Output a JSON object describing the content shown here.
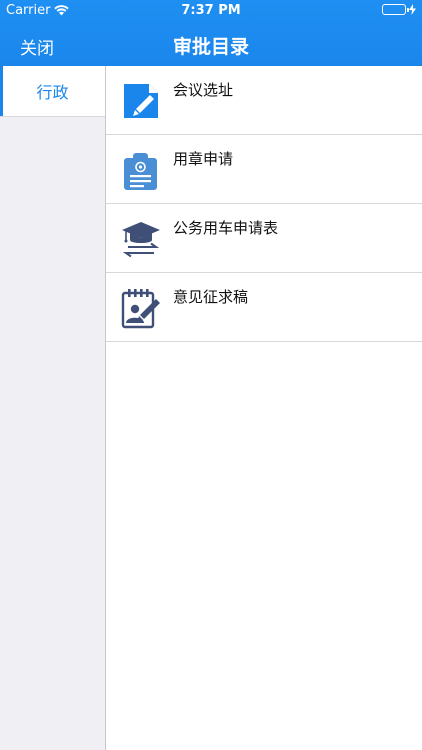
{
  "status_bar": {
    "carrier": "Carrier",
    "time": "7:37 PM"
  },
  "nav": {
    "close_label": "关闭",
    "title": "审批目录"
  },
  "sidebar": {
    "items": [
      {
        "label": "行政"
      }
    ]
  },
  "list": {
    "items": [
      {
        "label": "会议选址",
        "icon": "document-edit-icon"
      },
      {
        "label": "用章申请",
        "icon": "clipboard-seal-icon"
      },
      {
        "label": "公务用车申请表",
        "icon": "mortarboard-transfer-icon"
      },
      {
        "label": "意见征求稿",
        "icon": "notepad-user-icon"
      }
    ]
  },
  "colors": {
    "accent": "#1a86ec",
    "icon_blue": "#1a86ec",
    "icon_navy": "#3f4f78"
  }
}
